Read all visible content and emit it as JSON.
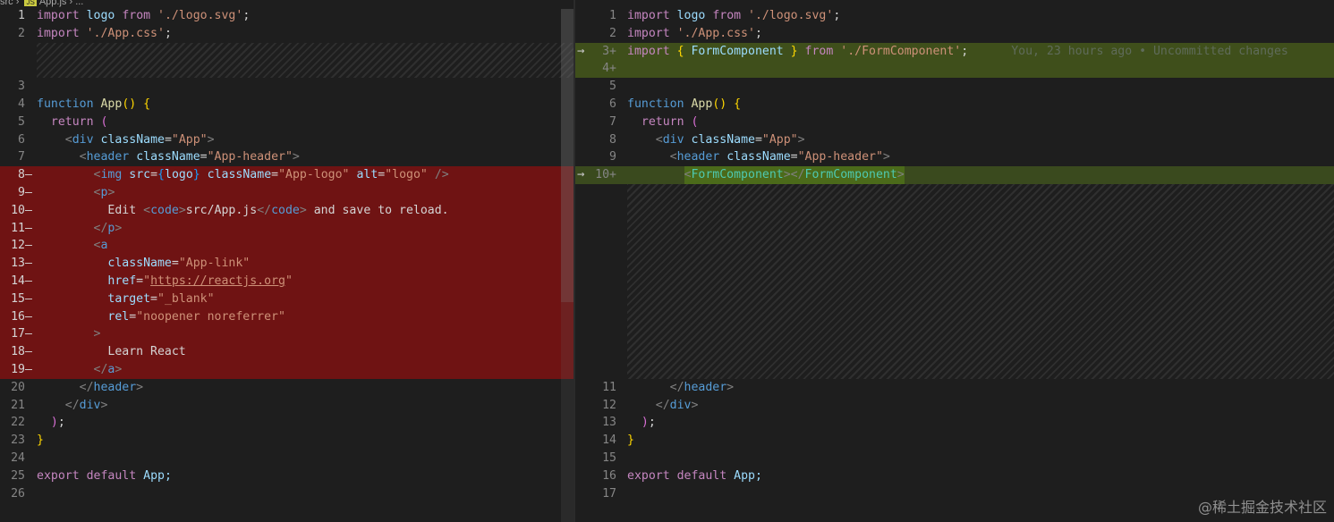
{
  "breadcrumb": {
    "folder": "src",
    "sep1": "›",
    "file_badge": "JS",
    "file": "App.js",
    "sep2": "›",
    "more": "..."
  },
  "left": {
    "n1": "1",
    "n2": "2",
    "n3": "3",
    "n4": "4",
    "n5": "5",
    "n6": "6",
    "n7": "7",
    "n8": "8",
    "n9": "9",
    "n10": "10",
    "n11": "11",
    "n12": "12",
    "n13": "13",
    "n14": "14",
    "n15": "15",
    "n16": "16",
    "n17": "17",
    "n18": "18",
    "n19": "19",
    "n20": "20",
    "n21": "21",
    "n22": "22",
    "n23": "23",
    "n24": "24",
    "n25": "25",
    "n26": "26",
    "removed_marker": "—"
  },
  "right": {
    "n1": "1",
    "n2": "2",
    "n3": "3+",
    "n4": "4+",
    "n5": "5",
    "n6": "6",
    "n7": "7",
    "n8": "8",
    "n9": "9",
    "n10": "10+",
    "n11": "11",
    "n12": "12",
    "n13": "13",
    "n14": "14",
    "n15": "15",
    "n16": "16",
    "n17": "17",
    "arrow": "→",
    "blame": "You, 23 hours ago • Uncommitted changes"
  },
  "code": {
    "import": "import",
    "from": "from",
    "function": "function",
    "return": "return",
    "export": "export",
    "default": "default",
    "logo": "logo",
    "logo_svg": "'./logo.svg'",
    "app_css": "'./App.css'",
    "semi": ";",
    "App": "App",
    "parens": "()",
    "lbrace": "{",
    "rbrace": "}",
    "lparen": "(",
    "rparen": ")",
    "lt": "<",
    "gt": ">",
    "lts": "</",
    "selfclose": "/>",
    "div": "div",
    "header": "header",
    "img": "img",
    "p": "p",
    "a": "a",
    "code_tag": "code",
    "className": "className",
    "src": "src",
    "alt": "alt",
    "href": "href",
    "target": "target",
    "rel": "rel",
    "eq": "=",
    "v_app": "\"App\"",
    "v_app_header": "\"App-header\"",
    "v_app_logo": "\"App-logo\"",
    "v_logo": "\"logo\"",
    "v_app_link": "\"App-link\"",
    "v_quote": "\"",
    "v_url": "https://reactjs.org",
    "v_blank": "\"_blank\"",
    "v_rel": "\"noopener noreferrer\"",
    "edit": "Edit ",
    "src_path": "src/App.js",
    "and_save": " and save to reload.",
    "learn": "Learn React",
    "FormComponent": "FormComponent",
    "form_path": "'./FormComponent'",
    "App_end": "App;",
    "lbrace_sp": "{ ",
    "rbrace_sp": " }"
  },
  "watermark": "@稀土掘金技术社区"
}
